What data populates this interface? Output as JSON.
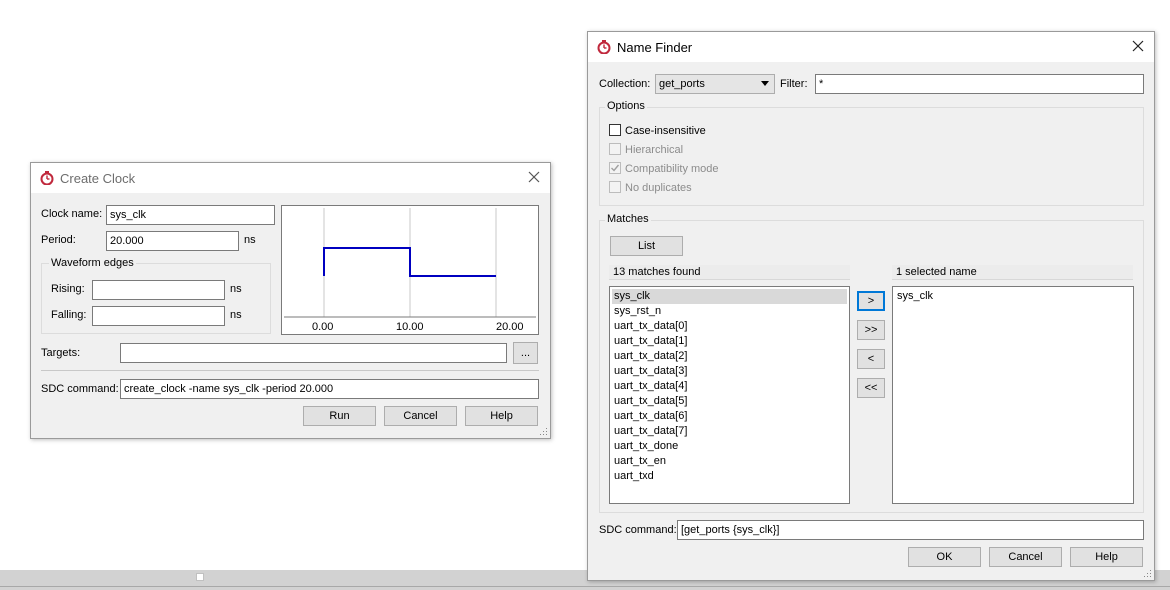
{
  "create_clock": {
    "title": "Create Clock",
    "clock_name_label": "Clock name:",
    "clock_name_value": "sys_clk",
    "period_label": "Period:",
    "period_value": "20.000",
    "period_unit": "ns",
    "waveform_group_title": "Waveform edges",
    "rising_label": "Rising:",
    "rising_value": "",
    "rising_unit": "ns",
    "falling_label": "Falling:",
    "falling_value": "",
    "falling_unit": "ns",
    "waveform_ticks": [
      "0.00",
      "10.00",
      "20.00"
    ],
    "waveform_color": "#0000c0",
    "targets_label": "Targets:",
    "targets_value": "",
    "browse_label": "...",
    "sdc_label": "SDC command:",
    "sdc_value": "create_clock -name sys_clk -period 20.000",
    "run_label": "Run",
    "cancel_label": "Cancel",
    "help_label": "Help"
  },
  "name_finder": {
    "title": "Name Finder",
    "collection_label": "Collection:",
    "collection_value": "get_ports",
    "filter_label": "Filter:",
    "filter_value": "*",
    "options_title": "Options",
    "options": {
      "case_insensitive": {
        "label": "Case-insensitive",
        "checked": false,
        "enabled": true
      },
      "hierarchical": {
        "label": "Hierarchical",
        "checked": false,
        "enabled": false
      },
      "compatibility_mode": {
        "label": "Compatibility mode",
        "checked": true,
        "enabled": false
      },
      "no_duplicates": {
        "label": "No duplicates",
        "checked": false,
        "enabled": false
      }
    },
    "matches_title": "Matches",
    "list_button": "List",
    "matches_header": "13 matches found",
    "matches": [
      "sys_clk",
      "sys_rst_n",
      "uart_tx_data[0]",
      "uart_tx_data[1]",
      "uart_tx_data[2]",
      "uart_tx_data[3]",
      "uart_tx_data[4]",
      "uart_tx_data[5]",
      "uart_tx_data[6]",
      "uart_tx_data[7]",
      "uart_tx_done",
      "uart_tx_en",
      "uart_txd"
    ],
    "selected_match": "sys_clk",
    "selected_header": "1 selected name",
    "selected_names": [
      "sys_clk"
    ],
    "move_buttons": {
      "add": ">",
      "add_all": ">>",
      "remove": "<",
      "remove_all": "<<"
    },
    "sdc_label": "SDC command:",
    "sdc_value": "[get_ports {sys_clk}]",
    "ok_label": "OK",
    "cancel_label": "Cancel",
    "help_label": "Help"
  },
  "colors": {
    "dialog_bg": "#f0f0f0",
    "focus_border": "#0078d7",
    "selection_bg": "#d9d9d9"
  },
  "icons": {
    "app_icon": "stopwatch-icon",
    "close": "close-icon"
  }
}
